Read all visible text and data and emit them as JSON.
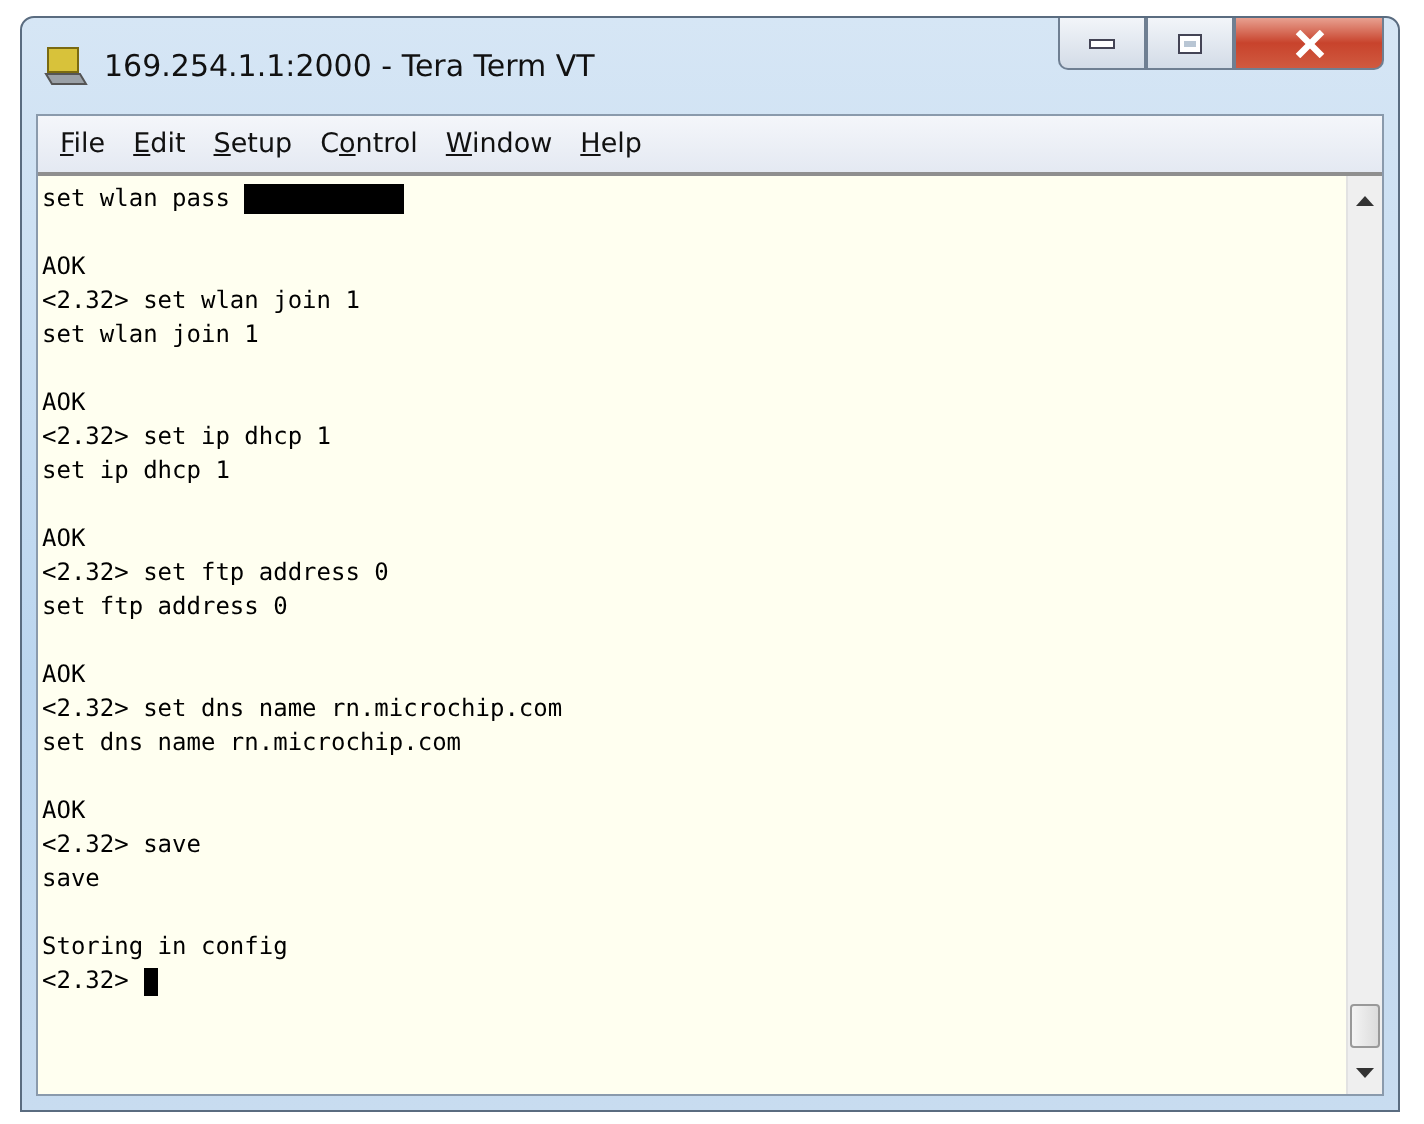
{
  "window": {
    "title": "169.254.1.1:2000 - Tera Term VT"
  },
  "menu": [
    {
      "key": "F",
      "post": "ile"
    },
    {
      "key": "E",
      "post": "dit"
    },
    {
      "key": "S",
      "post": "etup"
    },
    {
      "pre": "C",
      "key": "o",
      "post": "ntrol"
    },
    {
      "key": "W",
      "post": "indow"
    },
    {
      "key": "H",
      "post": "elp"
    }
  ],
  "terminal": {
    "blocks": [
      [
        {
          "text": "set wlan pass ",
          "masked": true
        }
      ],
      [
        {
          "text": "AOK"
        },
        {
          "text": "<2.32> set wlan join 1"
        },
        {
          "text": "set wlan join 1"
        }
      ],
      [
        {
          "text": "AOK"
        },
        {
          "text": "<2.32> set ip dhcp 1"
        },
        {
          "text": "set ip dhcp 1"
        }
      ],
      [
        {
          "text": "AOK"
        },
        {
          "text": "<2.32> set ftp address 0"
        },
        {
          "text": "set ftp address 0"
        }
      ],
      [
        {
          "text": "AOK"
        },
        {
          "text": "<2.32> set dns name rn.microchip.com"
        },
        {
          "text": "set dns name rn.microchip.com"
        }
      ],
      [
        {
          "text": "AOK"
        },
        {
          "text": "<2.32> save"
        },
        {
          "text": "save"
        }
      ],
      [
        {
          "text": "Storing in config"
        },
        {
          "text": "<2.32> ",
          "cursor": true
        }
      ]
    ]
  }
}
